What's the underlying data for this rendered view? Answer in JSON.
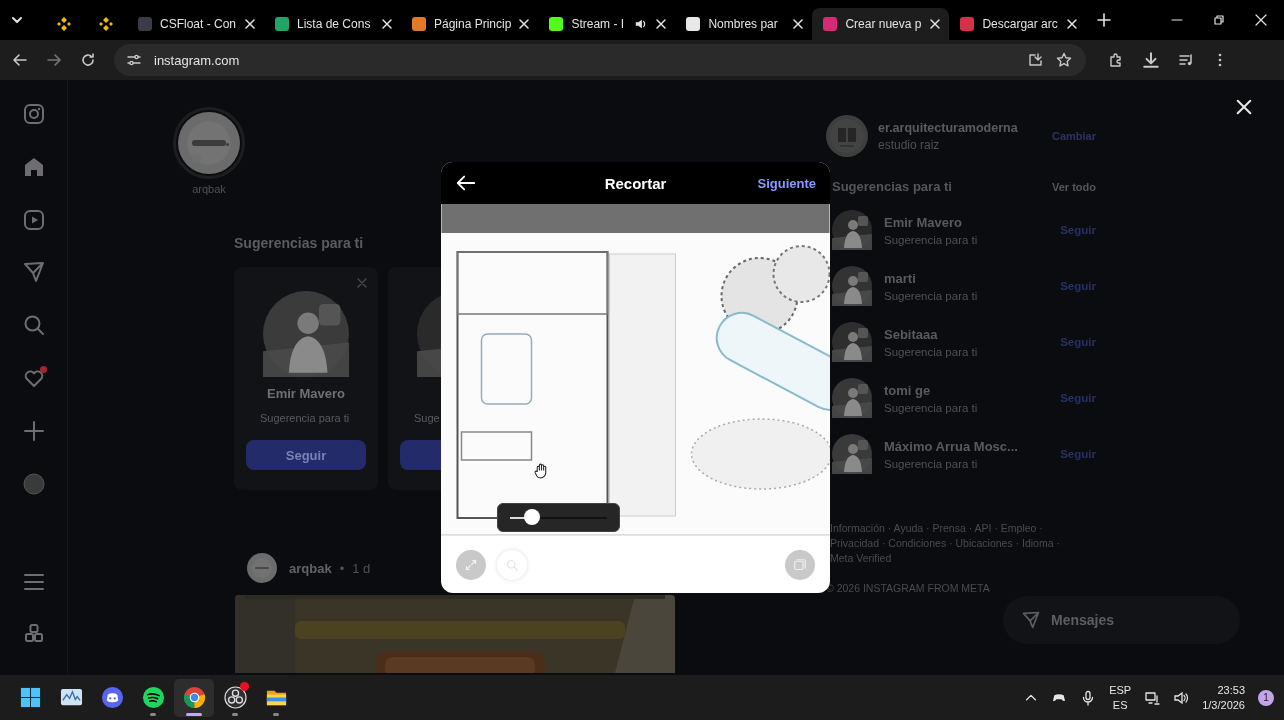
{
  "browser": {
    "tabs": [
      {
        "pinned": true,
        "color": "#f0b90b",
        "selected": false,
        "audio": false
      },
      {
        "pinned": true,
        "color": "#f0b90b",
        "selected": false,
        "audio": false
      },
      {
        "pinned": false,
        "title": "CSFloat - Con",
        "color": "#3a3a48",
        "selected": false,
        "audio": false
      },
      {
        "pinned": false,
        "title": "Lista de Cons",
        "color": "#21a464",
        "selected": false,
        "audio": false
      },
      {
        "pinned": false,
        "title": "Página Princip",
        "color": "#e07a2a",
        "selected": false,
        "audio": false
      },
      {
        "pinned": false,
        "title": "Stream - I",
        "color": "#53fc18",
        "selected": false,
        "audio": true
      },
      {
        "pinned": false,
        "title": "Nombres par",
        "color": "#e8e8e8",
        "selected": false,
        "audio": false
      },
      {
        "pinned": false,
        "title": "Crear nueva p",
        "color": "#d62976",
        "selected": true,
        "audio": false
      },
      {
        "pinned": false,
        "title": "Descargar arc",
        "color": "#d6304a",
        "selected": false,
        "audio": false
      }
    ],
    "address": "instagram.com"
  },
  "instagram": {
    "nav": [
      {
        "kind": "logo",
        "alert": false
      },
      {
        "kind": "home",
        "alert": false
      },
      {
        "kind": "reels",
        "alert": false
      },
      {
        "kind": "messages",
        "alert": false
      },
      {
        "kind": "search",
        "alert": false
      },
      {
        "kind": "notifications",
        "alert": true
      },
      {
        "kind": "create",
        "alert": false
      },
      {
        "kind": "profile",
        "alert": false
      },
      {
        "kind": "more",
        "alert": false
      },
      {
        "kind": "apps",
        "alert": false
      }
    ],
    "story": {
      "name": "arqbak"
    },
    "suggestions": {
      "title": "Sugerencias para ti",
      "cards": [
        {
          "name": "Emir Mavero",
          "subtitle": "Sugerencia para ti",
          "button": "Seguir",
          "dismiss": true
        },
        {
          "subtitle": "Suge",
          "dismiss": false
        }
      ]
    },
    "post": {
      "author": "arqbak",
      "separator": "•",
      "time": "1 d"
    },
    "sidebar": {
      "account": {
        "username": "er.arquitecturamoderna",
        "name": "estudio raiz",
        "action": "Cambiar"
      },
      "suggestions_title": "Sugerencias para ti",
      "see_all": "Ver todo",
      "people": [
        {
          "name": "Emir Mavero",
          "subtitle": "Sugerencia para ti",
          "button": "Seguir"
        },
        {
          "name": "marti",
          "subtitle": "Sugerencia para ti",
          "button": "Seguir"
        },
        {
          "name": "Sebitaaa",
          "subtitle": "Sugerencia para ti",
          "button": "Seguir"
        },
        {
          "name": "tomi ge",
          "subtitle": "Sugerencia para ti",
          "button": "Seguir"
        },
        {
          "name": "Máximo Arrua Mosc...",
          "subtitle": "Sugerencia para ti",
          "button": "Seguir"
        }
      ],
      "footer_lines": [
        "Información · Ayuda · Prensa · API · Empleo ·",
        "Privacidad · Condiciones · Ubicaciones · Idioma ·",
        "Meta Verified"
      ],
      "copyright": "© 2026 INSTAGRAM FROM META"
    },
    "messages_button": "Mensajes",
    "modal": {
      "title": "Recortar",
      "next": "Siguiente",
      "zoom": {
        "level": 0.23
      },
      "tools": [
        {
          "kind": "aspect",
          "selected": false
        },
        {
          "kind": "zoom",
          "selected": true
        },
        {
          "kind": "gallery",
          "selected": false
        }
      ]
    }
  },
  "taskbar": {
    "apps": [
      {
        "kind": "start",
        "active": false,
        "running": false,
        "notification": false
      },
      {
        "kind": "monitor",
        "active": false,
        "running": false,
        "notification": false
      },
      {
        "kind": "discord",
        "active": false,
        "running": false,
        "notification": false
      },
      {
        "kind": "spotify",
        "active": false,
        "running": true,
        "notification": false
      },
      {
        "kind": "chrome",
        "active": true,
        "running": true,
        "notification": false
      },
      {
        "kind": "obs",
        "active": false,
        "running": true,
        "notification": true
      },
      {
        "kind": "files",
        "active": false,
        "running": true,
        "notification": false
      }
    ],
    "tray": {
      "language": "ESP",
      "layout": "ES",
      "time": "23:53",
      "date": "1/3/2026",
      "notifications": "1"
    }
  }
}
